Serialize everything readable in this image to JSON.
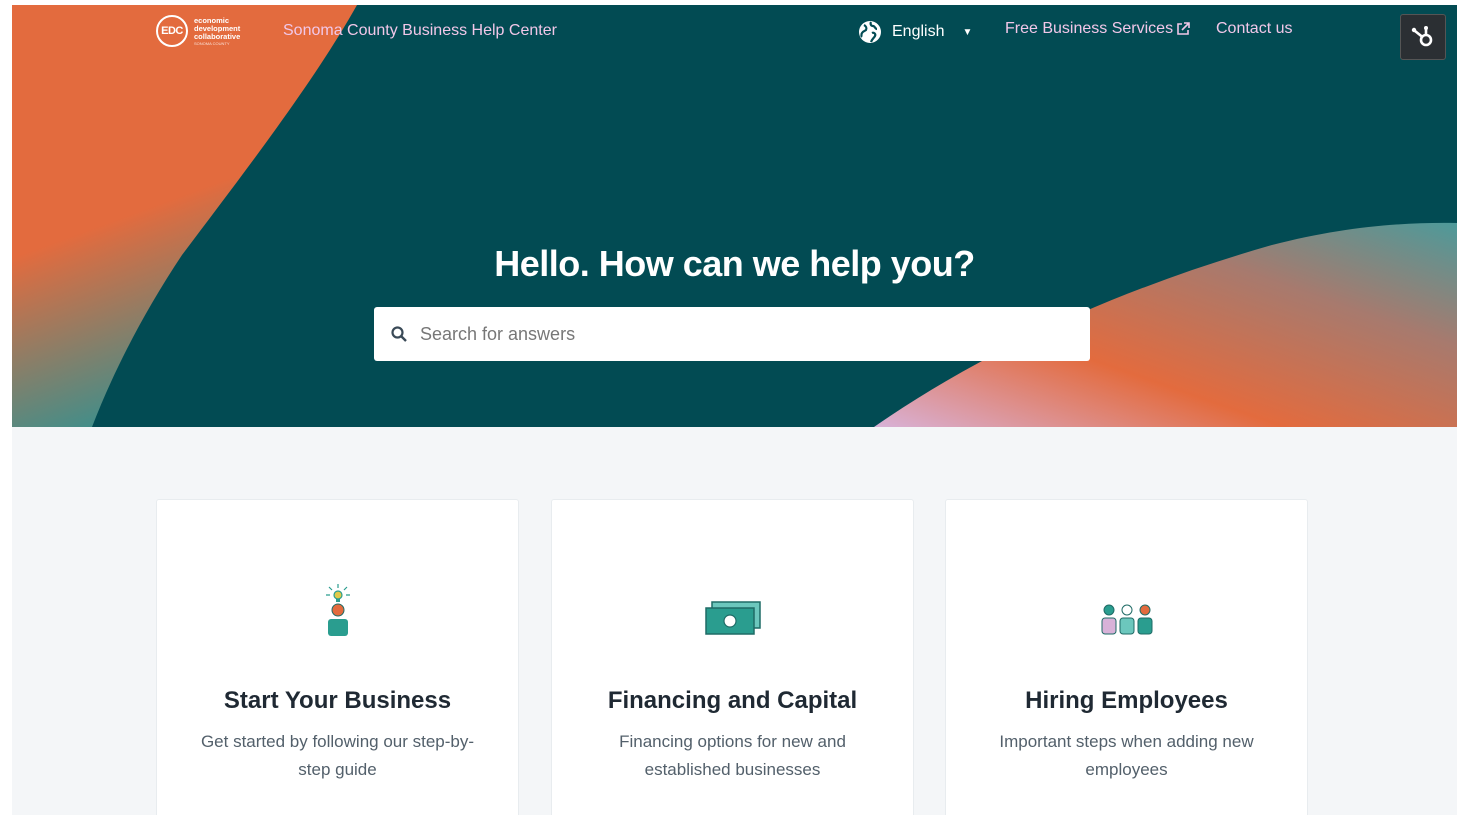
{
  "header": {
    "logo": {
      "mark": "EDC",
      "line1": "economic",
      "line2": "development",
      "line3": "collaborative",
      "line4": "SONOMA COUNTY"
    },
    "site_title": "Sonoma County Business Help Center",
    "language": "English",
    "free_services_label": "Free Business Services",
    "contact_label": "Contact us"
  },
  "hero": {
    "title": "Hello. How can we help you?",
    "search_placeholder": "Search for answers"
  },
  "cards": [
    {
      "title": "Start Your Business",
      "description": "Get started by following our step-by-step guide",
      "icon": "person-lightbulb-icon"
    },
    {
      "title": "Financing and Capital",
      "description": "Financing options for new and established businesses",
      "icon": "money-bills-icon"
    },
    {
      "title": "Hiring Employees",
      "description": "Important steps when adding new employees",
      "icon": "team-icon"
    }
  ],
  "colors": {
    "hero_bg": "#024b53",
    "accent_orange": "#e36b3e",
    "link_pink": "#f1c7e8",
    "teal": "#2a9d8f"
  }
}
